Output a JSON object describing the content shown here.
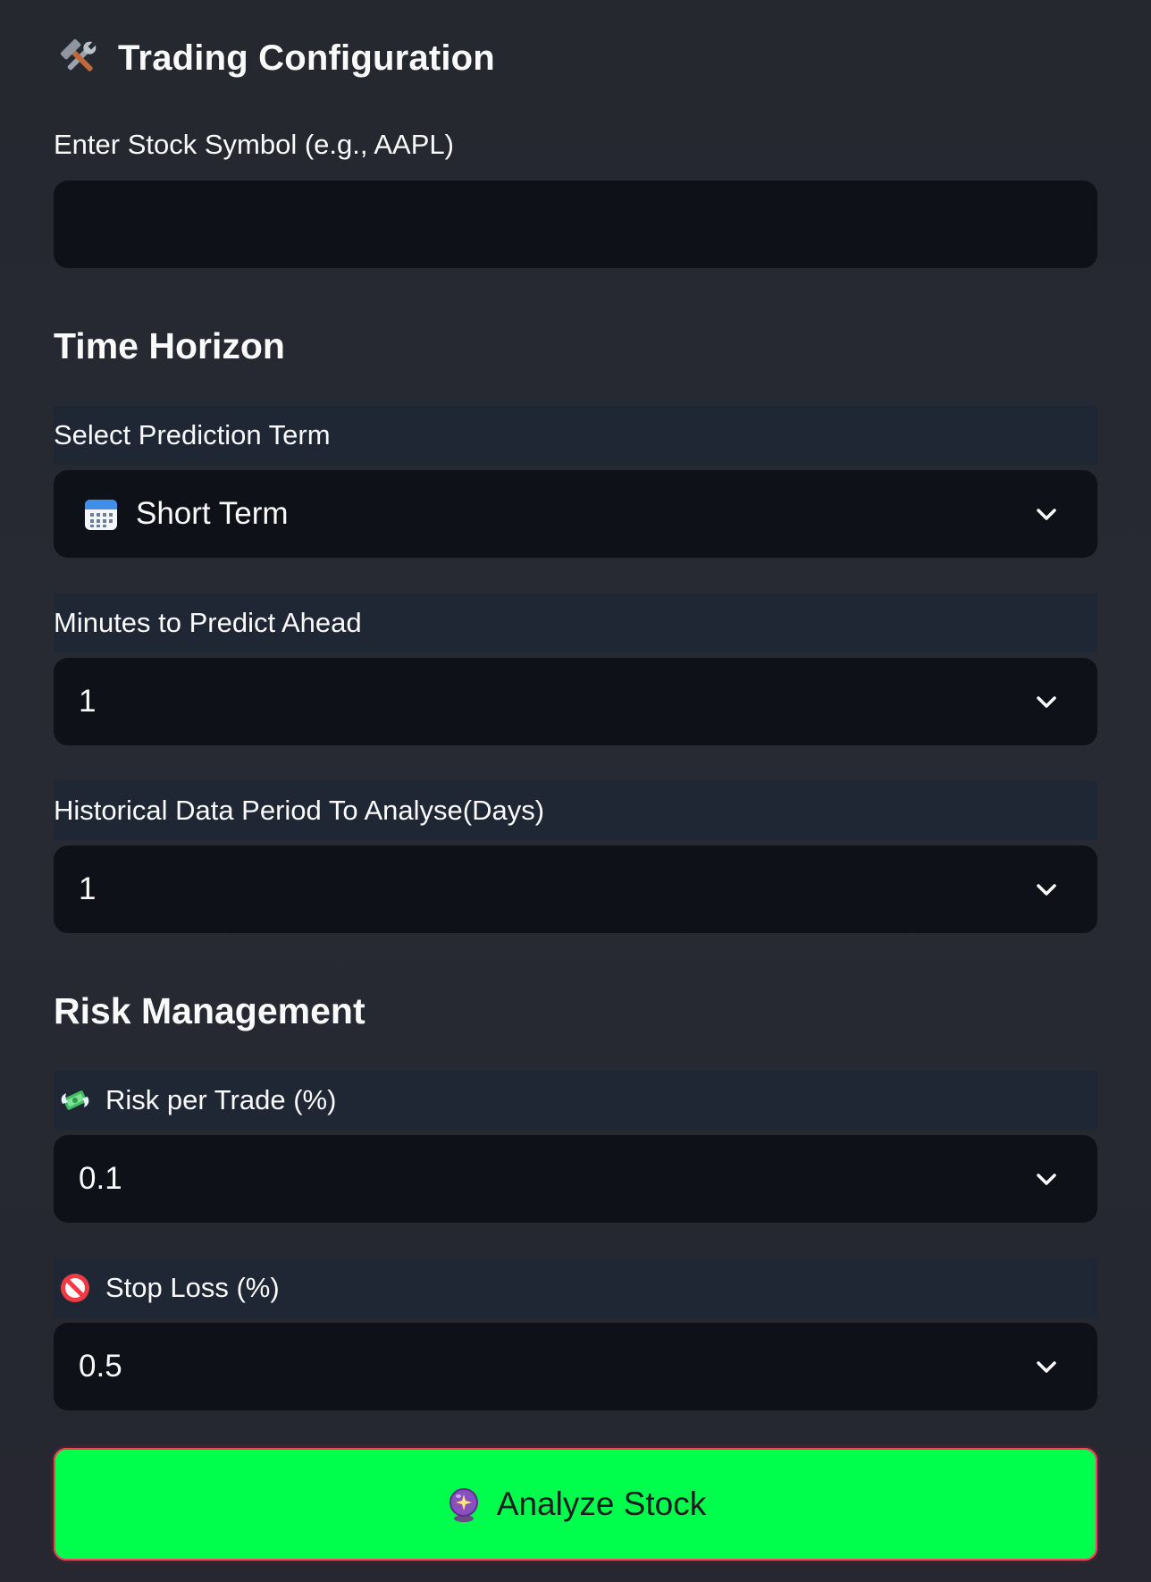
{
  "config": {
    "title": "Trading Configuration",
    "title_icon": "hammer-and-wrench-icon"
  },
  "symbol": {
    "label": "Enter Stock Symbol (e.g., AAPL)",
    "value": "",
    "placeholder": ""
  },
  "time_horizon": {
    "heading": "Time Horizon",
    "prediction_term": {
      "label": "Select Prediction Term",
      "value": "Short Term",
      "icon": "calendar-icon"
    },
    "minutes_ahead": {
      "label": "Minutes to Predict Ahead",
      "value": "1"
    },
    "historical_period": {
      "label": "Historical Data Period To Analyse(Days)",
      "value": "1"
    }
  },
  "risk": {
    "heading": "Risk Management",
    "risk_per_trade": {
      "label": "Risk per Trade (%)",
      "value": "0.1",
      "icon": "money-with-wings-icon"
    },
    "stop_loss": {
      "label": "Stop Loss (%)",
      "value": "0.5",
      "icon": "no-entry-icon"
    }
  },
  "action": {
    "label": "Analyze Stock",
    "icon": "crystal-ball-icon"
  },
  "colors": {
    "background": "#262730",
    "input_bg": "#0e1117",
    "label_band": "#1f2735",
    "button_bg": "#00ff4d",
    "button_border": "#ff3a5e",
    "text": "#fafafa"
  }
}
